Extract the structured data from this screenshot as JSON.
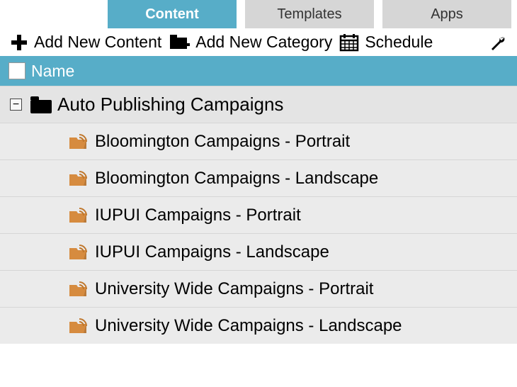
{
  "tabs": [
    {
      "label": "Content",
      "active": true
    },
    {
      "label": "Templates",
      "active": false
    },
    {
      "label": "Apps",
      "active": false
    }
  ],
  "toolbar": {
    "add_content": "Add New Content",
    "add_category": "Add New Category",
    "schedule": "Schedule"
  },
  "column_header": "Name",
  "tree": {
    "root_label": "Auto Publishing Campaigns",
    "children": [
      "Bloomington Campaigns - Portrait",
      "Bloomington Campaigns - Landscape",
      "IUPUI Campaigns - Portrait",
      "IUPUI Campaigns - Landscape",
      "University Wide Campaigns - Portrait",
      "University Wide Campaigns - Landscape"
    ]
  }
}
